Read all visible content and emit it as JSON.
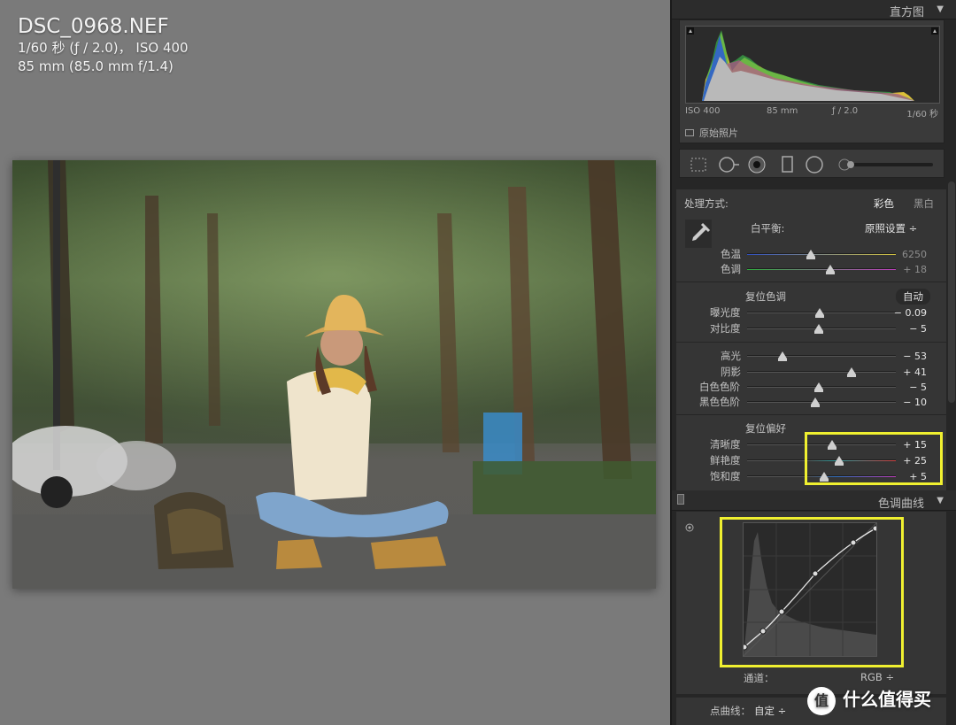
{
  "image_info": {
    "filename": "DSC_0968.NEF",
    "exposure_line": "1/60 秒 (ƒ / 2.0)， ISO 400",
    "lens_line": "85 mm (85.0 mm f/1.4)"
  },
  "panel": {
    "histogram": {
      "title": "直方图",
      "iso": "ISO 400",
      "focal": "85 mm",
      "aperture": "ƒ / 2.0",
      "shutter": "1/60 秒",
      "original_label": "原始照片"
    },
    "basic": {
      "treatment_label": "处理方式:",
      "color_option": "彩色",
      "bw_option": "黑白",
      "wb_label": "白平衡:",
      "wb_value": "原照设置 ÷",
      "sliders": [
        {
          "label": "色温",
          "value": "6250",
          "level": 0.43
        },
        {
          "label": "色调",
          "value": "+ 18",
          "level": 0.56
        },
        {
          "label": "曝光度",
          "value": "− 0.09",
          "level": 0.49
        },
        {
          "label": "对比度",
          "value": "− 5",
          "level": 0.48
        },
        {
          "label": "高光",
          "value": "− 53",
          "level": 0.24
        },
        {
          "label": "阴影",
          "value": "+ 41",
          "level": 0.7
        },
        {
          "label": "白色色阶",
          "value": "− 5",
          "level": 0.48
        },
        {
          "label": "黑色色阶",
          "value": "− 10",
          "level": 0.46
        },
        {
          "label": "清晰度",
          "value": "+ 15",
          "level": 0.57
        },
        {
          "label": "鲜艳度",
          "value": "+ 25",
          "level": 0.62
        },
        {
          "label": "饱和度",
          "value": "+ 5",
          "level": 0.52
        }
      ],
      "tone_label": "复位色调",
      "auto_label": "自动",
      "presence_label": "复位偏好"
    },
    "tone_curve": {
      "title": "色调曲线",
      "channel_label": "通道：",
      "channel_value": "RGB ÷",
      "point_curve_label": "点曲线：",
      "point_curve_value": "自定 ÷"
    }
  },
  "watermark": {
    "logo": "值",
    "text": "什么值得买"
  },
  "colors": {
    "highlight": "#f0f030",
    "panel_bg": "#262626",
    "canvas_bg": "#7a7a7a"
  }
}
